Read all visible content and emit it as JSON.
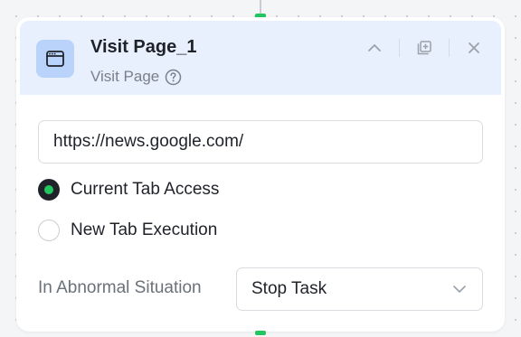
{
  "node": {
    "title": "Visit Page_1",
    "subtitle": "Visit Page"
  },
  "icons": {
    "node": "browser-window-icon",
    "help": "question-circle-icon",
    "collapse": "chevron-up-icon",
    "copy": "copy-add-icon",
    "close": "close-icon",
    "dropdown": "chevron-down-icon"
  },
  "url_field": {
    "value": "https://news.google.com/"
  },
  "tab_options": [
    {
      "label": "Current Tab Access",
      "selected": true
    },
    {
      "label": "New Tab Execution",
      "selected": false
    }
  ],
  "abnormal": {
    "label": "In Abnormal Situation",
    "selected": "Stop Task"
  },
  "colors": {
    "accent": "#22c55e",
    "header_bg": "#e8f0fe",
    "icon_bg": "#b9d3fb"
  }
}
